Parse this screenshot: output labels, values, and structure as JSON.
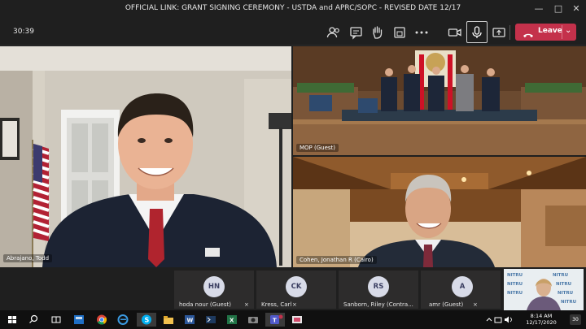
{
  "window": {
    "title": "OFFICIAL LINK: GRANT SIGNING CEREMONY - USTDA and APRC/SOPC - REVISED DATE 12/17",
    "minimize_icon": "minimize-icon",
    "maximize_icon": "maximize-icon",
    "close_icon": "close-icon"
  },
  "toolbar": {
    "timer": "30:39",
    "icons": [
      "participants-icon",
      "chat-icon",
      "raise-hand-icon",
      "share-tray-icon",
      "more-actions-icon",
      "camera-icon",
      "microphone-icon",
      "share-screen-icon"
    ],
    "leave_label": "Leave",
    "leave_color": "#c4314b"
  },
  "videos": {
    "main_name": "Abrajano, Todd",
    "top_right_name": "MOP (Guest)",
    "bottom_right_name": "Cohen, Jonathan R (Cairo)"
  },
  "participants": [
    {
      "initials": "HN",
      "name": "hoda nour (Guest)"
    },
    {
      "initials": "CK",
      "name": "Kress, Carl"
    },
    {
      "initials": "RS",
      "name": "Sanborn, Riley (Contra..."
    },
    {
      "initials": "A",
      "name": "amr (Guest)"
    }
  ],
  "self_view": {
    "background_text": "NITRU"
  },
  "taskbar": {
    "time": "8:14 AM",
    "date": "12/17/2020",
    "notification_count": "30",
    "apps": [
      "windows-start-icon",
      "search-icon",
      "task-view-icon",
      "calculator-icon",
      "chrome-icon",
      "edge-icon",
      "skype-icon",
      "file-explorer-icon",
      "word-icon",
      "terminal-icon",
      "excel-icon",
      "camera-app-icon",
      "teams-icon",
      "snipping-icon"
    ]
  }
}
